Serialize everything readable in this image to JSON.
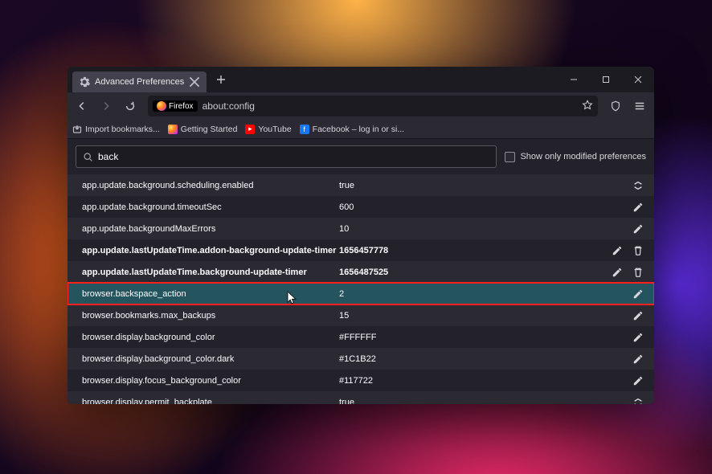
{
  "tab": {
    "title": "Advanced Preferences"
  },
  "addr": {
    "pill": "Firefox",
    "url": "about:config"
  },
  "bookmarks": [
    {
      "icon": "import",
      "label": "Import bookmarks..."
    },
    {
      "icon": "ff",
      "label": "Getting Started"
    },
    {
      "icon": "yt",
      "label": "YouTube"
    },
    {
      "icon": "fb",
      "label": "Facebook – log in or si..."
    }
  ],
  "search": {
    "value": "back",
    "show_only_label": "Show only modified preferences"
  },
  "prefs": [
    {
      "name": "app.update.background.scheduling.enabled",
      "value": "true",
      "action": "toggle",
      "modified": false,
      "highlight": false,
      "reset": false
    },
    {
      "name": "app.update.background.timeoutSec",
      "value": "600",
      "action": "edit",
      "modified": false,
      "highlight": false,
      "reset": false
    },
    {
      "name": "app.update.backgroundMaxErrors",
      "value": "10",
      "action": "edit",
      "modified": false,
      "highlight": false,
      "reset": false
    },
    {
      "name": "app.update.lastUpdateTime.addon-background-update-timer",
      "value": "1656457778",
      "action": "edit",
      "modified": true,
      "highlight": false,
      "reset": true
    },
    {
      "name": "app.update.lastUpdateTime.background-update-timer",
      "value": "1656487525",
      "action": "edit",
      "modified": true,
      "highlight": false,
      "reset": true
    },
    {
      "name": "browser.backspace_action",
      "value": "2",
      "action": "edit",
      "modified": false,
      "highlight": true,
      "reset": false
    },
    {
      "name": "browser.bookmarks.max_backups",
      "value": "15",
      "action": "edit",
      "modified": false,
      "highlight": false,
      "reset": false
    },
    {
      "name": "browser.display.background_color",
      "value": "#FFFFFF",
      "action": "edit",
      "modified": false,
      "highlight": false,
      "reset": false
    },
    {
      "name": "browser.display.background_color.dark",
      "value": "#1C1B22",
      "action": "edit",
      "modified": false,
      "highlight": false,
      "reset": false
    },
    {
      "name": "browser.display.focus_background_color",
      "value": "#117722",
      "action": "edit",
      "modified": false,
      "highlight": false,
      "reset": false
    },
    {
      "name": "browser.display.permit_backplate",
      "value": "true",
      "action": "toggle",
      "modified": false,
      "highlight": false,
      "reset": false
    }
  ]
}
